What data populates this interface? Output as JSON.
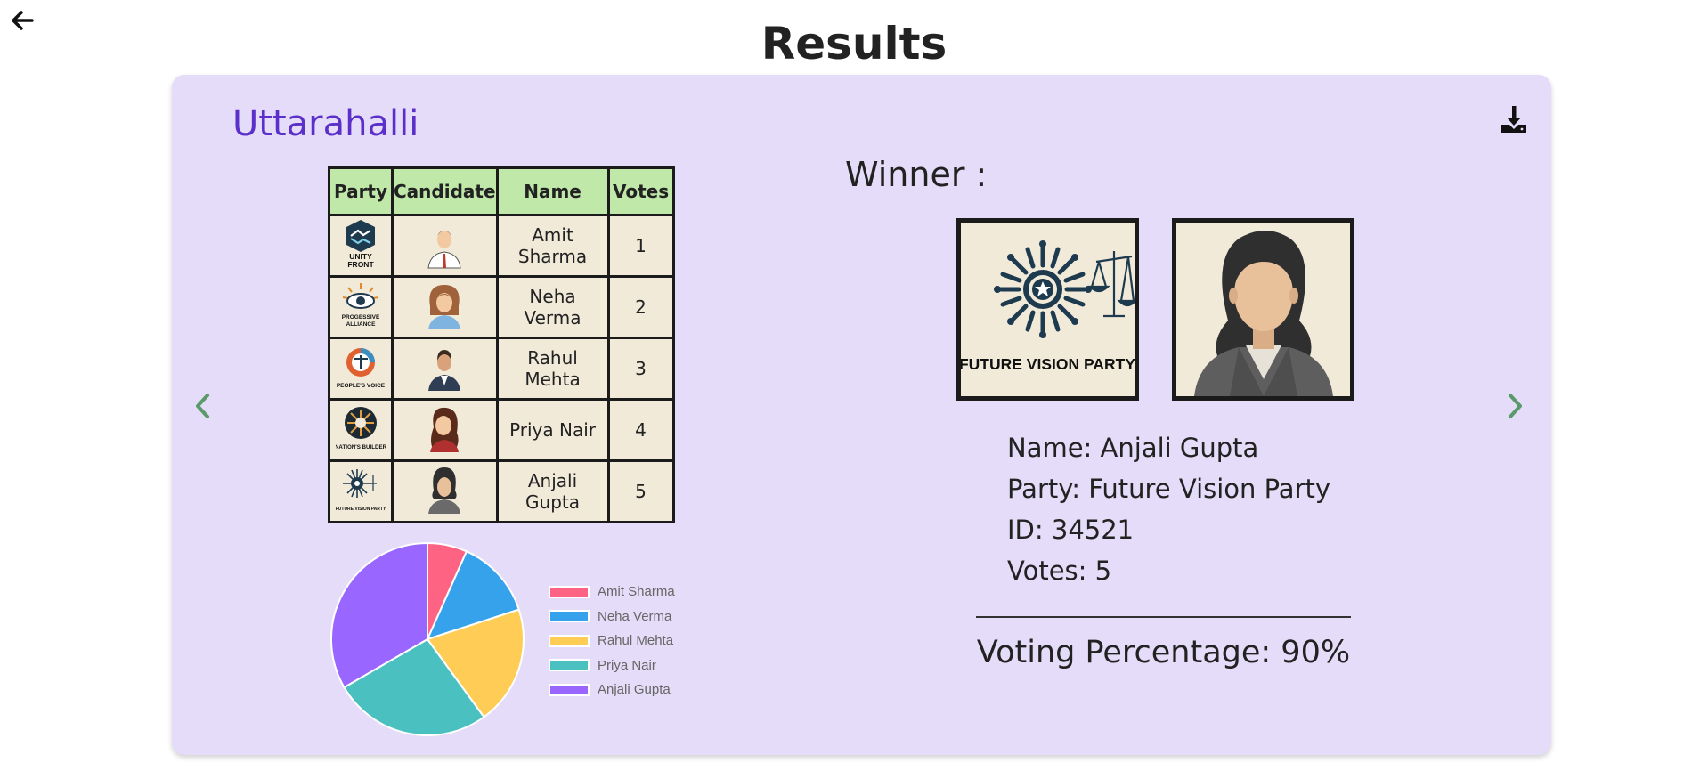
{
  "page": {
    "title": "Results"
  },
  "card": {
    "constituency": "Uttarahalli",
    "table": {
      "headers": [
        "Party",
        "Candidate",
        "Name",
        "Votes"
      ],
      "rows": [
        {
          "party_logo_text": "UNITY FRONT",
          "name": "Amit Sharma",
          "votes": "1"
        },
        {
          "party_logo_text": "PROGESSIVE ALLIANCE",
          "name": "Neha Verma",
          "votes": "2"
        },
        {
          "party_logo_text": "PEOPLE'S VOICE",
          "name": "Rahul Mehta",
          "votes": "3"
        },
        {
          "party_logo_text": "NATION'S BUILDER",
          "name": "Priya Nair",
          "votes": "4"
        },
        {
          "party_logo_text": "FUTURE VISION PARTY",
          "name": "Anjali Gupta",
          "votes": "5"
        }
      ]
    },
    "winner": {
      "label": "Winner :",
      "logo_text": "FUTURE VISION PARTY",
      "name_line": "Name: Anjali Gupta",
      "party_line": "Party: Future Vision Party",
      "id_line": "ID: 34521",
      "votes_line": "Votes: 5"
    },
    "voting_percentage": "Voting Percentage: 90%"
  },
  "chart_data": {
    "type": "pie",
    "categories": [
      "Amit Sharma",
      "Neha Verma",
      "Rahul Mehta",
      "Priya Nair",
      "Anjali Gupta"
    ],
    "values": [
      1,
      2,
      3,
      4,
      5
    ],
    "colors": [
      "#ff6384",
      "#36a2eb",
      "#ffcd56",
      "#4bc0c0",
      "#9966ff"
    ],
    "legend_position": "right"
  },
  "icons": {
    "back": "arrow-left-icon",
    "download": "download-icon",
    "prev": "chevron-left-icon",
    "next": "chevron-right-icon"
  }
}
